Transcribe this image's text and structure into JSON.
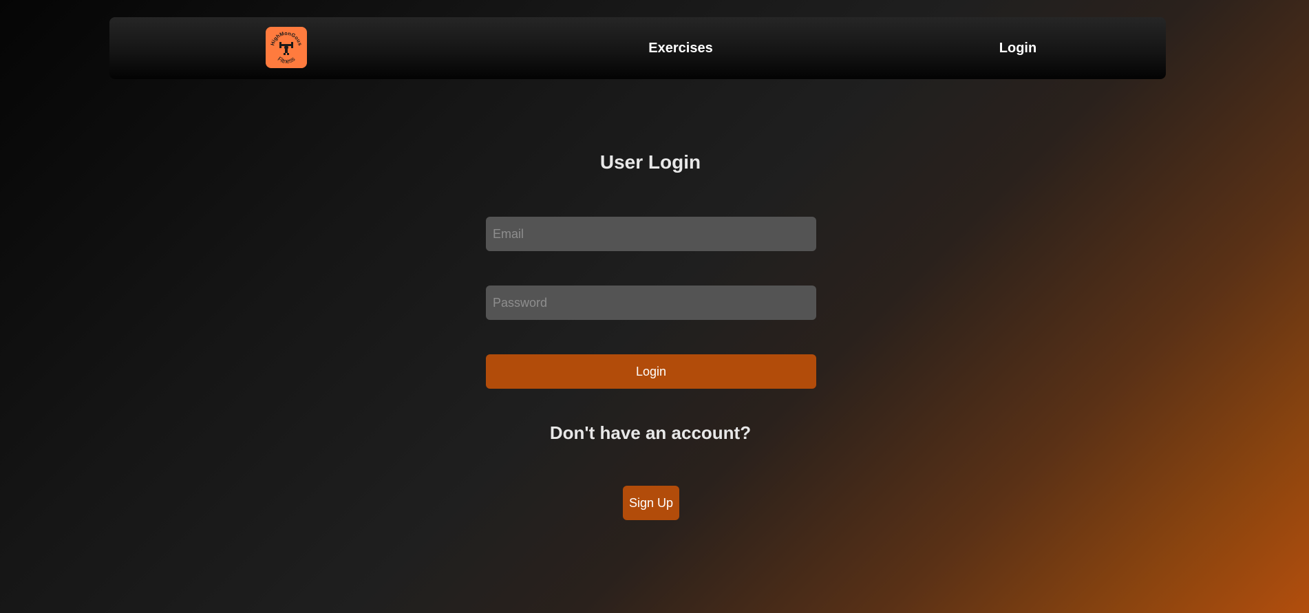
{
  "navbar": {
    "logo": {
      "icon": "fitness-logo-icon",
      "top_arc_text": "HighMonGous",
      "bottom_arc_text": "Fitness",
      "background_color": "#ff7b3e"
    },
    "links": [
      {
        "label": "Exercises"
      },
      {
        "label": "Login"
      }
    ]
  },
  "main": {
    "title": "User Login",
    "email_placeholder": "Email",
    "password_placeholder": "Password",
    "login_button": "Login",
    "no_account_text": "Don't have an account?",
    "signup_button": "Sign Up"
  },
  "colors": {
    "accent": "#b24c0a",
    "input_background": "#545454",
    "text": "#e6e6e6"
  }
}
